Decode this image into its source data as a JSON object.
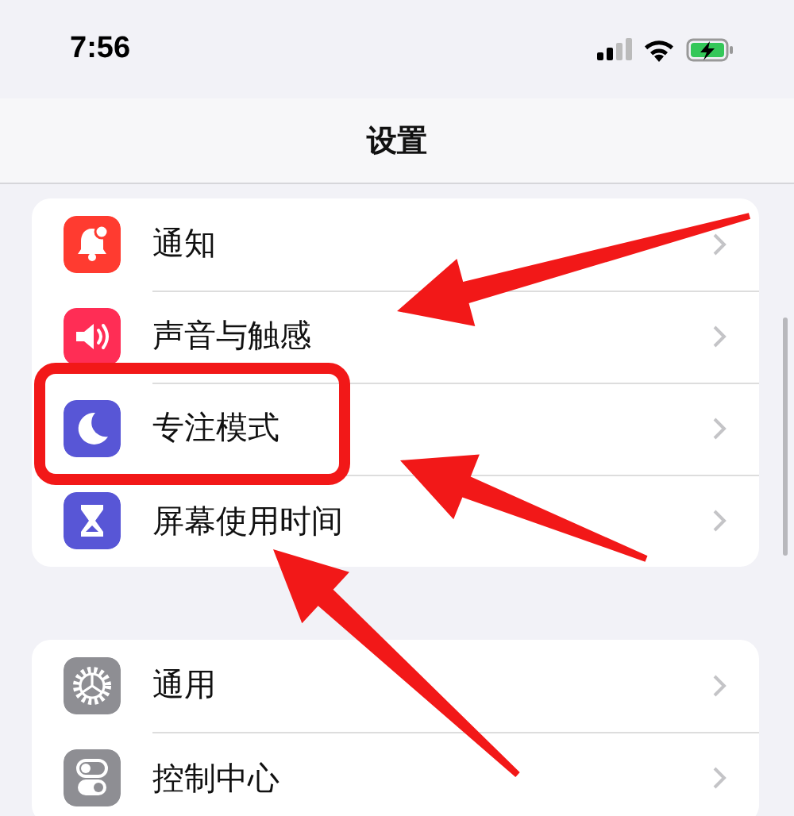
{
  "status_bar": {
    "time": "7:56"
  },
  "nav": {
    "title": "设置"
  },
  "groups": [
    {
      "rows": [
        {
          "label": "通知",
          "kind": "bell",
          "color": "#ff3b30",
          "highlighted": false
        },
        {
          "label": "声音与触感",
          "kind": "speaker",
          "color": "#ff2d55",
          "highlighted": false
        },
        {
          "label": "专注模式",
          "kind": "moon",
          "color": "#5856d6",
          "highlighted": true
        },
        {
          "label": "屏幕使用时间",
          "kind": "hourglass",
          "color": "#5856d6",
          "highlighted": false
        }
      ]
    },
    {
      "rows": [
        {
          "label": "通用",
          "kind": "gear",
          "color": "#8e8e93",
          "highlighted": false
        },
        {
          "label": "控制中心",
          "kind": "toggles",
          "color": "#8e8e93",
          "highlighted": false
        }
      ]
    }
  ]
}
